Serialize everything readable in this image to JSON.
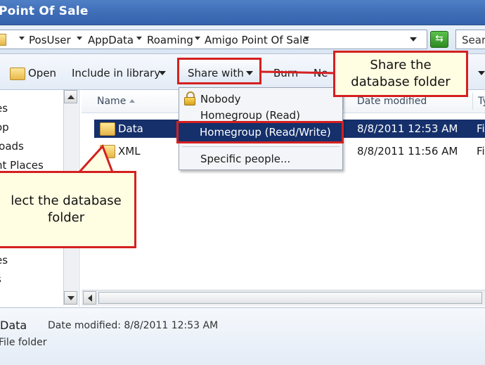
{
  "window": {
    "title": "Point Of Sale"
  },
  "address": {
    "breadcrumbs": [
      "PosUser",
      "AppData",
      "Roaming",
      "Amigo Point Of Sale"
    ],
    "search_placeholder": "Sear"
  },
  "toolbar": {
    "open_label": "Open",
    "include_label": "Include in library",
    "share_label": "Share with",
    "burn_label": "Burn",
    "new_label": "Ne"
  },
  "nav": {
    "items": [
      "es",
      "op",
      "loads",
      "nt Places",
      "es",
      "s"
    ]
  },
  "file_list": {
    "columns": {
      "name": "Name",
      "date": "Date modified",
      "type": "Ty"
    },
    "rows": [
      {
        "name": "Data",
        "date": "8/8/2011 12:53 AM",
        "type": "Fi",
        "selected": true
      },
      {
        "name": "XML",
        "date": "8/8/2011 11:56 AM",
        "type": "Fi",
        "selected": false
      }
    ]
  },
  "share_menu": {
    "items": [
      "Nobody",
      "Homegroup (Read)",
      "Homegroup (Read/Write)",
      "Specific people..."
    ]
  },
  "details": {
    "name": "Data",
    "modified": "Date modified: 8/8/2011 12:53 AM",
    "type": "File folder"
  },
  "callouts": {
    "share": [
      "Share the",
      "database folder"
    ],
    "select": [
      "lect the database",
      "folder"
    ]
  },
  "colors": {
    "accent_red": "#d42020",
    "selection": "#15306b",
    "callout_bg": "#fffde2"
  }
}
